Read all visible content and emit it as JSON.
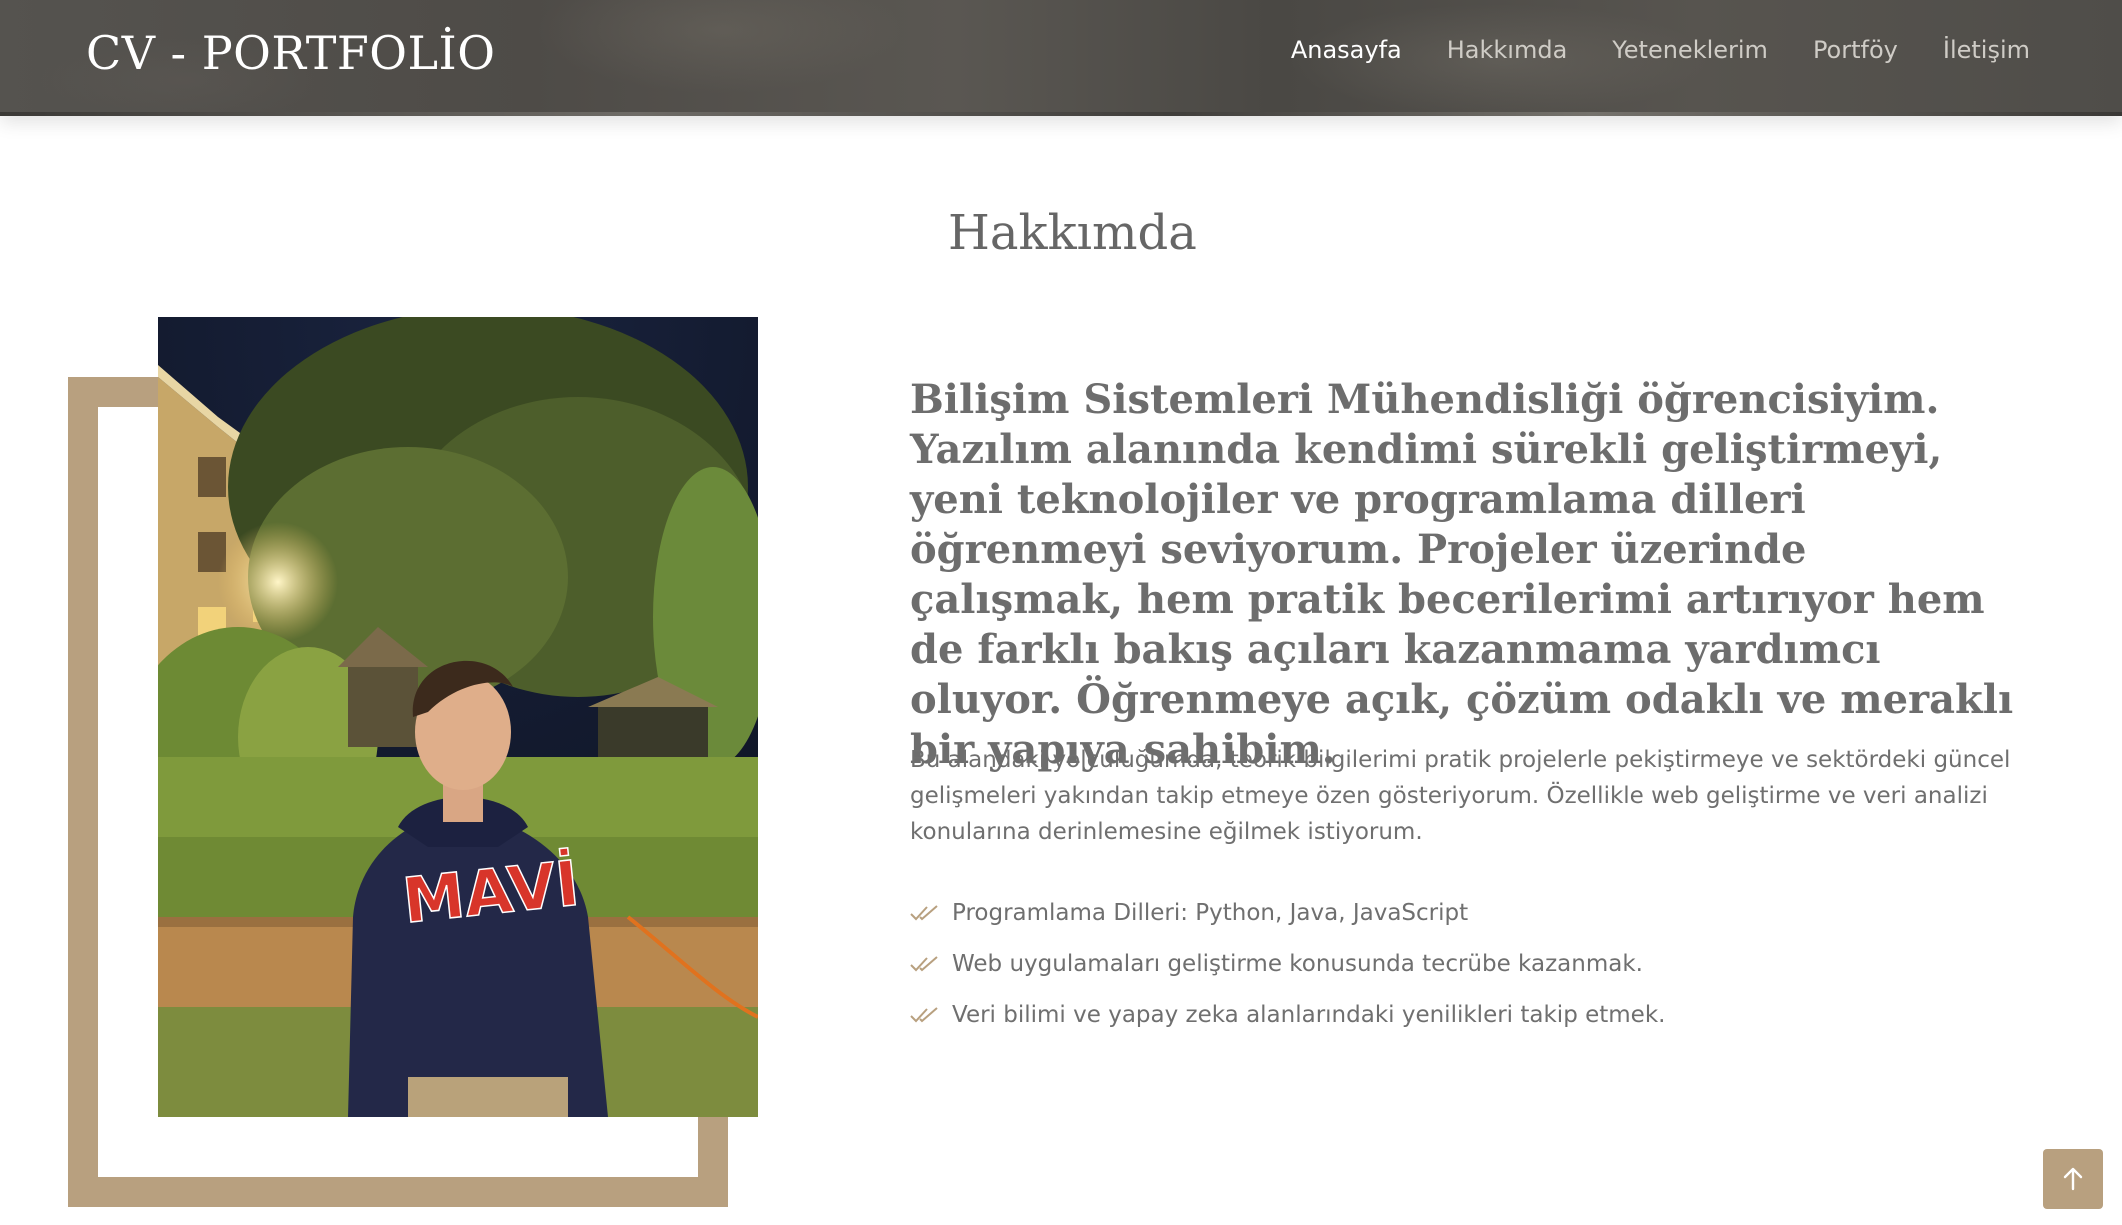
{
  "header": {
    "logo": "CV - PORTFOLİO",
    "nav": [
      {
        "label": "Anasayfa",
        "active": true
      },
      {
        "label": "Hakkımda",
        "active": false
      },
      {
        "label": "Yeteneklerim",
        "active": false
      },
      {
        "label": "Portföy",
        "active": false
      },
      {
        "label": "İletişim",
        "active": false
      }
    ]
  },
  "about": {
    "title": "Hakkımda",
    "lead": "Bilişim Sistemleri Mühendisliği öğrencisiyim. Yazılım alanında kendimi sürekli geliştirmeyi, yeni teknolojiler ve programlama dilleri öğrenmeyi seviyorum. Projeler üzerinde çalışmak, hem pratik becerilerimi artırıyor hem de farklı bakış açıları kazanmama yardımcı oluyor. Öğrenmeye açık, çözüm odaklı ve meraklı bir yapıya sahibim.",
    "description": "Bu alandaki yolculuğumda, teorik bilgilerimi pratik projelerle pekiştirmeye ve sektördeki güncel gelişmeleri yakından takip etmeye özen gösteriyorum. Özellikle web geliştirme ve veri analizi konularına derinlemesine eğilmek istiyorum.",
    "items": [
      "Programlama Dilleri: Python, Java, JavaScript",
      "Web uygulamaları geliştirme konusunda tecrübe kazanmak.",
      "Veri bilimi ve yapay zeka alanlarındaki yenilikleri takip etmek."
    ],
    "photo_sweater_text": "MAVİ"
  },
  "colors": {
    "accent": "#b8a07f",
    "text": "#6d6d6d",
    "header_bg": "#514e4a"
  },
  "icons": {
    "list_item": "double-check-icon",
    "back_to_top": "arrow-up-icon"
  }
}
